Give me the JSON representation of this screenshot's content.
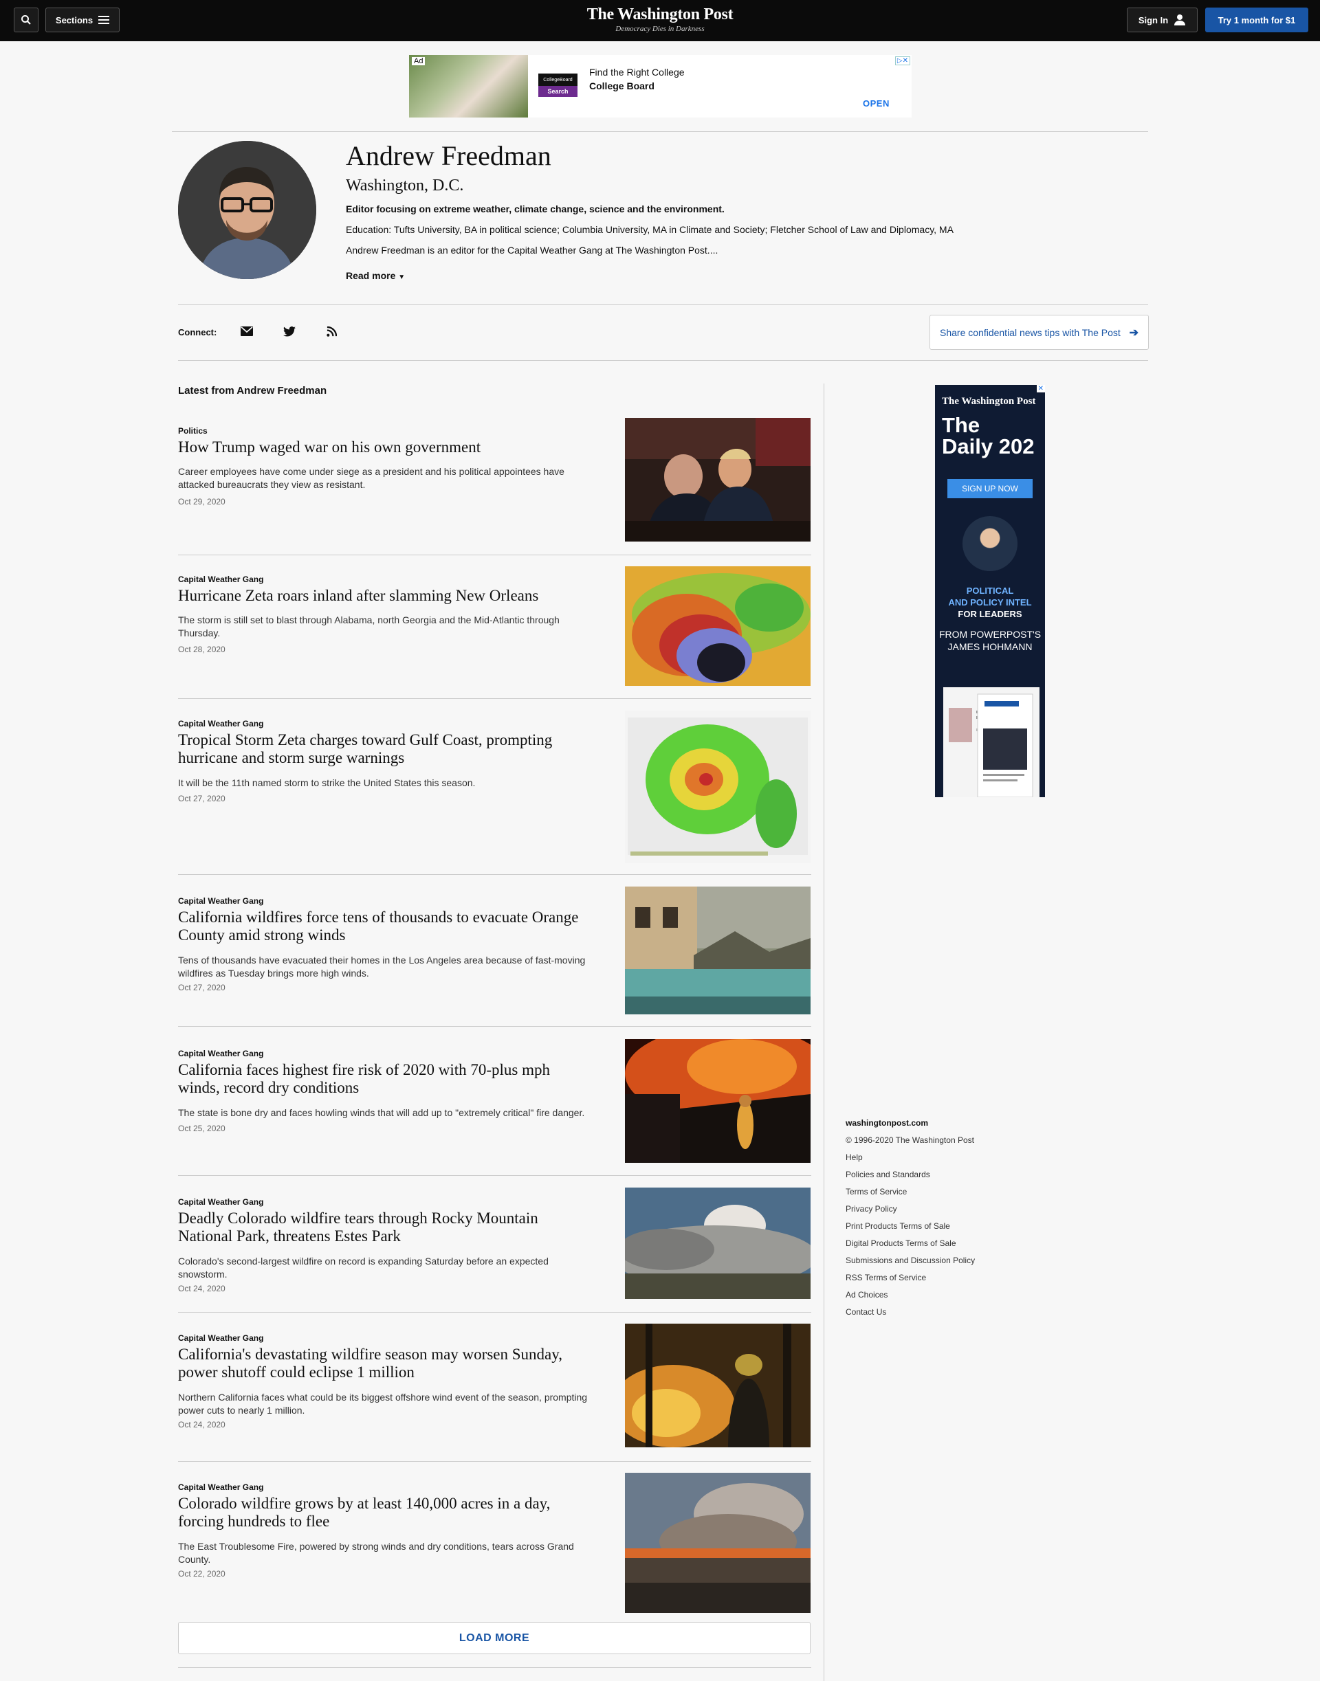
{
  "header": {
    "sections_label": "Sections",
    "logo_name": "The Washington Post",
    "logo_tagline": "Democracy Dies in Darkness",
    "signin_label": "Sign In",
    "try_label": "Try 1 month for $1"
  },
  "ad_banner": {
    "ad_tag": "Ad",
    "brand_logo": "CollegeBoard",
    "brand_button": "Search",
    "line1": "Find the Right College",
    "line2": "College Board",
    "open_label": "OPEN"
  },
  "author": {
    "name": "Andrew Freedman",
    "location": "Washington, D.C.",
    "focus": "Editor focusing on extreme weather, climate change, science and the environment.",
    "education": "Education: Tufts University, BA in political science; Columbia University, MA in Climate and Society; Fletcher School of Law and Diplomacy, MA",
    "description": "Andrew Freedman is an editor for the Capital Weather Gang at The Washington Post....",
    "read_more": "Read more"
  },
  "connect": {
    "label": "Connect:",
    "icons": [
      "email-icon",
      "twitter-icon",
      "rss-icon"
    ],
    "tips_label": "Share confidential news tips with The Post"
  },
  "latest_heading": "Latest from Andrew Freedman",
  "articles": [
    {
      "kicker": "Politics",
      "title": "How Trump waged war on his own government",
      "blurb": "Career employees have come under siege as a president and his political appointees have attacked bureaucrats they view as resistant.",
      "date": "Oct 29, 2020"
    },
    {
      "kicker": "Capital Weather Gang",
      "title": "Hurricane Zeta roars inland after slamming New Orleans",
      "blurb": "The storm is still set to blast through Alabama, north Georgia and the Mid-Atlantic through Thursday.",
      "date": "Oct 28, 2020"
    },
    {
      "kicker": "Capital Weather Gang",
      "title": "Tropical Storm Zeta charges toward Gulf Coast, prompting hurricane and storm surge warnings",
      "blurb": "It will be the 11th named storm to strike the United States this season.",
      "date": "Oct 27, 2020"
    },
    {
      "kicker": "Capital Weather Gang",
      "title": "California wildfires force tens of thousands to evacuate Orange County amid strong winds",
      "blurb": "Tens of thousands have evacuated their homes in the Los Angeles area because of fast-moving wildfires as Tuesday brings more high winds.",
      "date": "Oct 27, 2020"
    },
    {
      "kicker": "Capital Weather Gang",
      "title": "California faces highest fire risk of 2020 with 70-plus mph winds, record dry conditions",
      "blurb": "The state is bone dry and faces howling winds that will add up to \"extremely critical\" fire danger.",
      "date": "Oct 25, 2020"
    },
    {
      "kicker": "Capital Weather Gang",
      "title": "Deadly Colorado wildfire tears through Rocky Mountain National Park, threatens Estes Park",
      "blurb": "Colorado's second-largest wildfire on record is expanding Saturday before an expected snowstorm.",
      "date": "Oct 24, 2020"
    },
    {
      "kicker": "Capital Weather Gang",
      "title": "California's devastating wildfire season may worsen Sunday, power shutoff could eclipse 1 million",
      "blurb": "Northern California faces what could be its biggest offshore wind event of the season, prompting power cuts to nearly 1 million.",
      "date": "Oct 24, 2020"
    },
    {
      "kicker": "Capital Weather Gang",
      "title": "Colorado wildfire grows by at least 140,000 acres in a day, forcing hundreds to flee",
      "blurb": "The East Troublesome Fire, powered by strong winds and dry conditions, tears across Grand County.",
      "date": "Oct 22, 2020"
    }
  ],
  "load_more": "LOAD MORE",
  "sidebar_ad": {
    "logo": "The Washington Post",
    "title_line1": "The",
    "title_line2": "Daily 202",
    "signup": "SIGN UP NOW",
    "pitch1": "POLITICAL",
    "pitch2": "AND POLICY INTEL",
    "pitch3": "FOR LEADERS",
    "from1": "FROM POWERPOST'S",
    "from2": "JAMES HOHMANN"
  },
  "footer": {
    "site": "washingtonpost.com",
    "copyright": "© 1996-2020 The Washington Post",
    "links": [
      "Help",
      "Policies and Standards",
      "Terms of Service",
      "Privacy Policy",
      "Print Products Terms of Sale",
      "Digital Products Terms of Sale",
      "Submissions and Discussion Policy",
      "RSS Terms of Service",
      "Ad Choices",
      "Contact Us"
    ]
  },
  "colors": {
    "topbar": "#0b0b0b",
    "accent_blue": "#1955a5",
    "page_bg": "#f7f7f7"
  }
}
